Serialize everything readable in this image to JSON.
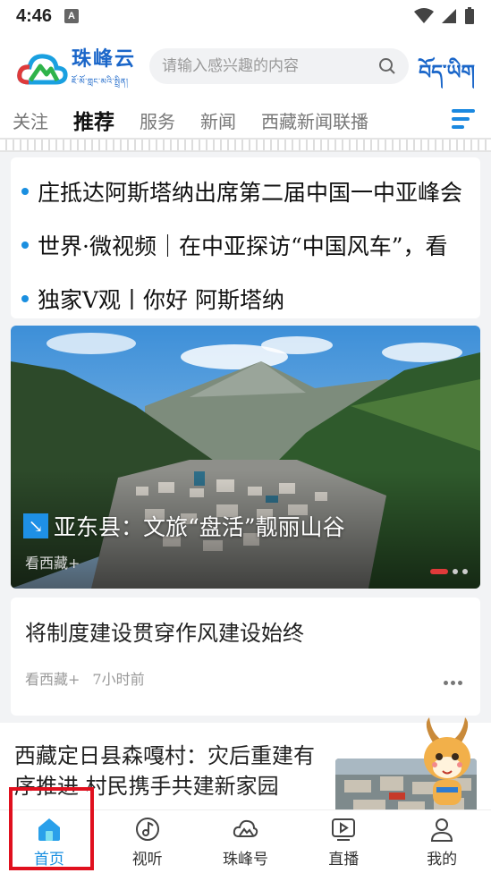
{
  "status": {
    "time": "4:46"
  },
  "header": {
    "logo_cn": "珠峰云",
    "logo_tib": "ཇོ་མོ་གླང་མའི་སྤྲིན།",
    "search_placeholder": "请输入感兴趣的内容",
    "lang_label": "བོད་ཡིག"
  },
  "tabs": [
    "关注",
    "推荐",
    "服务",
    "新闻",
    "西藏新闻联播"
  ],
  "active_tab": "推荐",
  "headlines": [
    "庄抵达阿斯塔纳出席第二届中国一中亚峰会",
    "世界·微视频｜在中亚探访“中国风车”，看",
    "独家V观丨你好 阿斯塔纳"
  ],
  "banner": {
    "title": "亚东县：文旅“盘活”靓丽山谷",
    "source": "看西藏+",
    "slide_count": 3,
    "active_slide": 1
  },
  "article1": {
    "title": "将制度建设贯穿作风建设始终",
    "source": "看西藏+",
    "time": "7小时前"
  },
  "article2": {
    "title": "西藏定日县森嘎村：灾后重建有序推进 村民携手共建新家园"
  },
  "nav": [
    {
      "label": "首页",
      "icon": "home-icon"
    },
    {
      "label": "视听",
      "icon": "music-note-icon"
    },
    {
      "label": "珠峰号",
      "icon": "cloud-icon"
    },
    {
      "label": "直播",
      "icon": "play-icon"
    },
    {
      "label": "我的",
      "icon": "user-icon"
    }
  ],
  "colors": {
    "accent": "#1a8fe0",
    "highlight": "#e0101e",
    "brand": "#1a66c9"
  }
}
